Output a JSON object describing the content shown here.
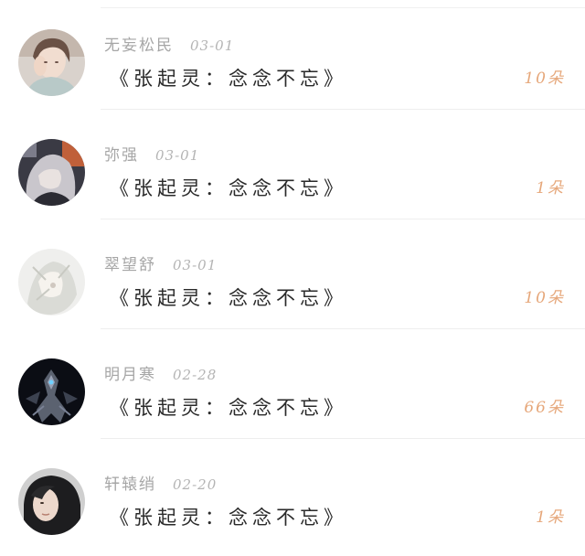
{
  "rows": [
    {
      "name": "无妄松民",
      "date": "03-01",
      "gift": "《张起灵：念念不忘》",
      "count": "10朵",
      "avatar_icon": "avatar-girl-hand-icon"
    },
    {
      "name": "弥强",
      "date": "03-01",
      "gift": "《张起灵：念念不忘》",
      "count": "1朵",
      "avatar_icon": "avatar-silver-hair-icon"
    },
    {
      "name": "翠望舒",
      "date": "03-01",
      "gift": "《张起灵：念念不忘》",
      "count": "10朵",
      "avatar_icon": "avatar-pale-figure-icon"
    },
    {
      "name": "明月寒",
      "date": "02-28",
      "gift": "《张起灵：念念不忘》",
      "count": "66朵",
      "avatar_icon": "avatar-dark-mech-icon"
    },
    {
      "name": "轩辕绡",
      "date": "02-20",
      "gift": "《张起灵：念念不忘》",
      "count": "1朵",
      "avatar_icon": "avatar-dark-hair-icon"
    }
  ],
  "colors": {
    "count": "#e6a77a",
    "meta": "#a6a6a6",
    "gift": "#2a2a2a",
    "divider": "#eeeeee"
  }
}
